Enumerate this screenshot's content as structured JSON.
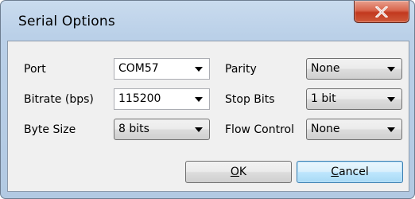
{
  "window": {
    "title": "Serial Options"
  },
  "fields": {
    "port": {
      "label": "Port",
      "value": "COM57"
    },
    "bitrate": {
      "label": "Bitrate (bps)",
      "value": "115200"
    },
    "byte_size": {
      "label": "Byte Size",
      "value": "8 bits"
    },
    "parity": {
      "label": "Parity",
      "value": "None"
    },
    "stop_bits": {
      "label": "Stop Bits",
      "value": "1 bit"
    },
    "flow_control": {
      "label": "Flow Control",
      "value": "None"
    }
  },
  "buttons": {
    "ok": {
      "mnemonic": "O",
      "rest": "K"
    },
    "cancel": {
      "mnemonic": "C",
      "rest": "ancel"
    }
  },
  "icons": {
    "close": "close-x-icon",
    "dropdown": "chevron-down-icon"
  },
  "colors": {
    "close_button": "#c7432a",
    "title_bar": "#bcd1e8",
    "client_bg": "#f0f0f0",
    "default_button_border": "#3c7fb1"
  }
}
